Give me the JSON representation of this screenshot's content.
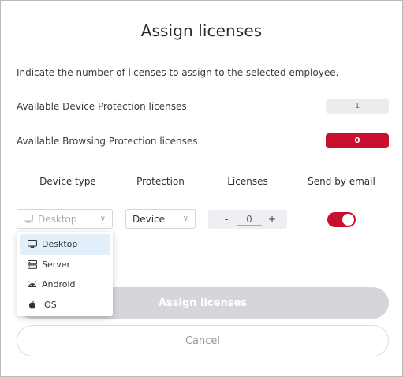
{
  "dialog": {
    "title": "Assign licenses",
    "intro": "Indicate the number of licenses to assign to the selected employee."
  },
  "availability": [
    {
      "label": "Available Device Protection licenses",
      "value": "1",
      "style": "grey"
    },
    {
      "label": "Available Browsing Protection licenses",
      "value": "0",
      "style": "red"
    }
  ],
  "columns": {
    "device_type": "Device type",
    "protection": "Protection",
    "licenses": "Licenses",
    "send_by_email": "Send by email"
  },
  "row": {
    "device_type_value": "Desktop",
    "device_type_icon": "desktop-icon",
    "protection_value": "Device",
    "licenses_value": "0",
    "minus": "-",
    "plus": "+",
    "send_by_email": true
  },
  "dropdown": {
    "options": [
      {
        "label": "Desktop",
        "icon": "desktop-icon",
        "selected": true
      },
      {
        "label": "Server",
        "icon": "server-icon",
        "selected": false
      },
      {
        "label": "Android",
        "icon": "android-icon",
        "selected": false
      },
      {
        "label": "iOS",
        "icon": "apple-icon",
        "selected": false
      }
    ]
  },
  "buttons": {
    "assign": "Assign licenses",
    "cancel": "Cancel"
  },
  "colors": {
    "accent": "#c8102e",
    "disabled_button": "#d4d6dc",
    "selected_option": "#e3f0fb"
  }
}
